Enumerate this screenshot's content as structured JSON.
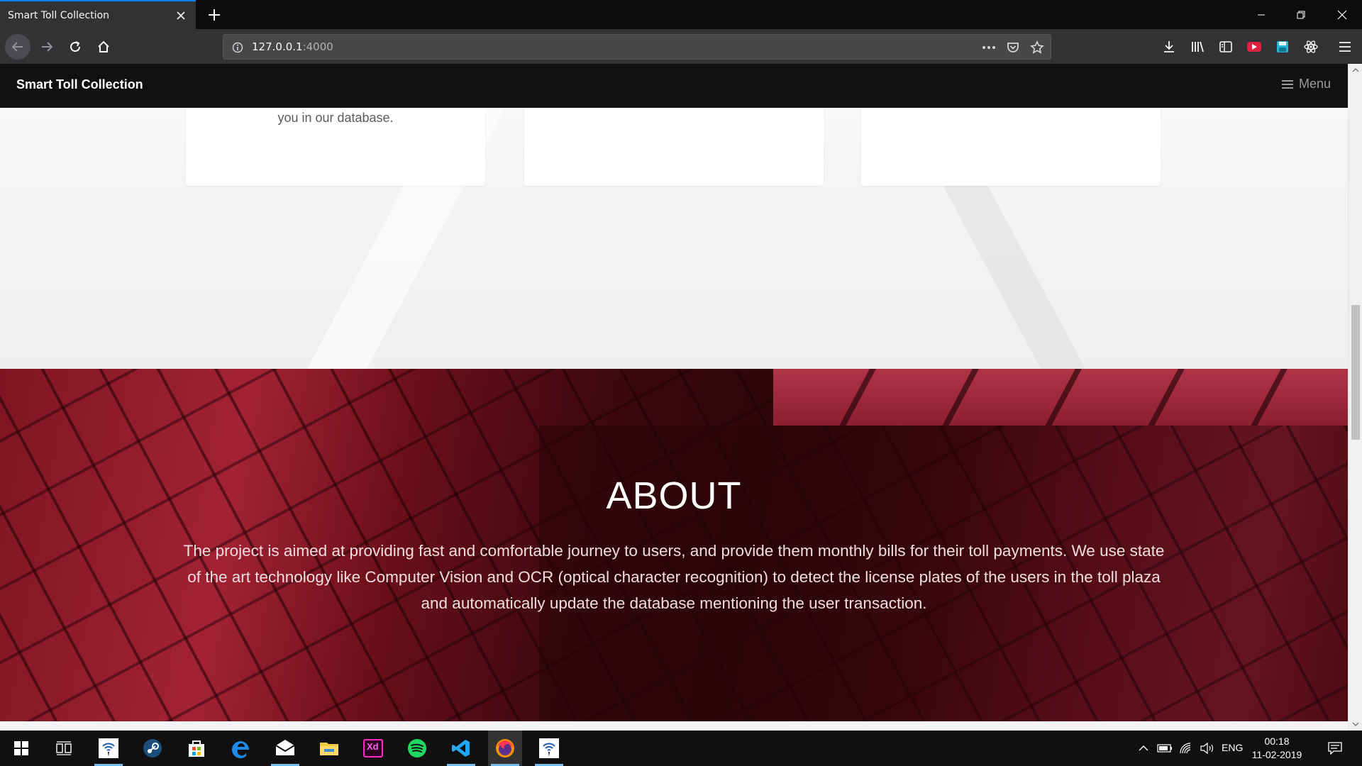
{
  "browser": {
    "tab_title": "Smart Toll Collection",
    "url_host": "127.0.0.1",
    "url_port": ":4000"
  },
  "site": {
    "brand": "Smart Toll Collection",
    "menu_label": "Menu",
    "cards": [
      {
        "text": "you in our database."
      },
      {
        "text": ""
      },
      {
        "text": ""
      }
    ],
    "about": {
      "title": "ABOUT",
      "body": "The project is aimed at providing fast and comfortable journey to users, and provide them monthly bills for their toll payments. We use state of the art technology like Computer Vision and OCR (optical character recognition) to detect the license plates of the users in the toll plaza and automatically update the database mentioning the user transaction."
    }
  },
  "taskbar": {
    "apps": [
      {
        "icon": "wifi-hotspot-icon"
      },
      {
        "icon": "steam-icon"
      },
      {
        "icon": "store-icon"
      },
      {
        "icon": "edge-icon"
      },
      {
        "icon": "mail-icon"
      },
      {
        "icon": "file-explorer-icon"
      },
      {
        "icon": "adobe-xd-icon",
        "label": "Xd"
      },
      {
        "icon": "spotify-icon"
      },
      {
        "icon": "vscode-icon"
      },
      {
        "icon": "firefox-icon"
      },
      {
        "icon": "wifi-hotspot-icon"
      }
    ],
    "language": "ENG",
    "time": "00:18",
    "date": "11-02-2019"
  },
  "colors": {
    "accent_tab": "#0a84ff",
    "about_red": "#8e1a2a",
    "site_nav_bg": "#111111"
  }
}
